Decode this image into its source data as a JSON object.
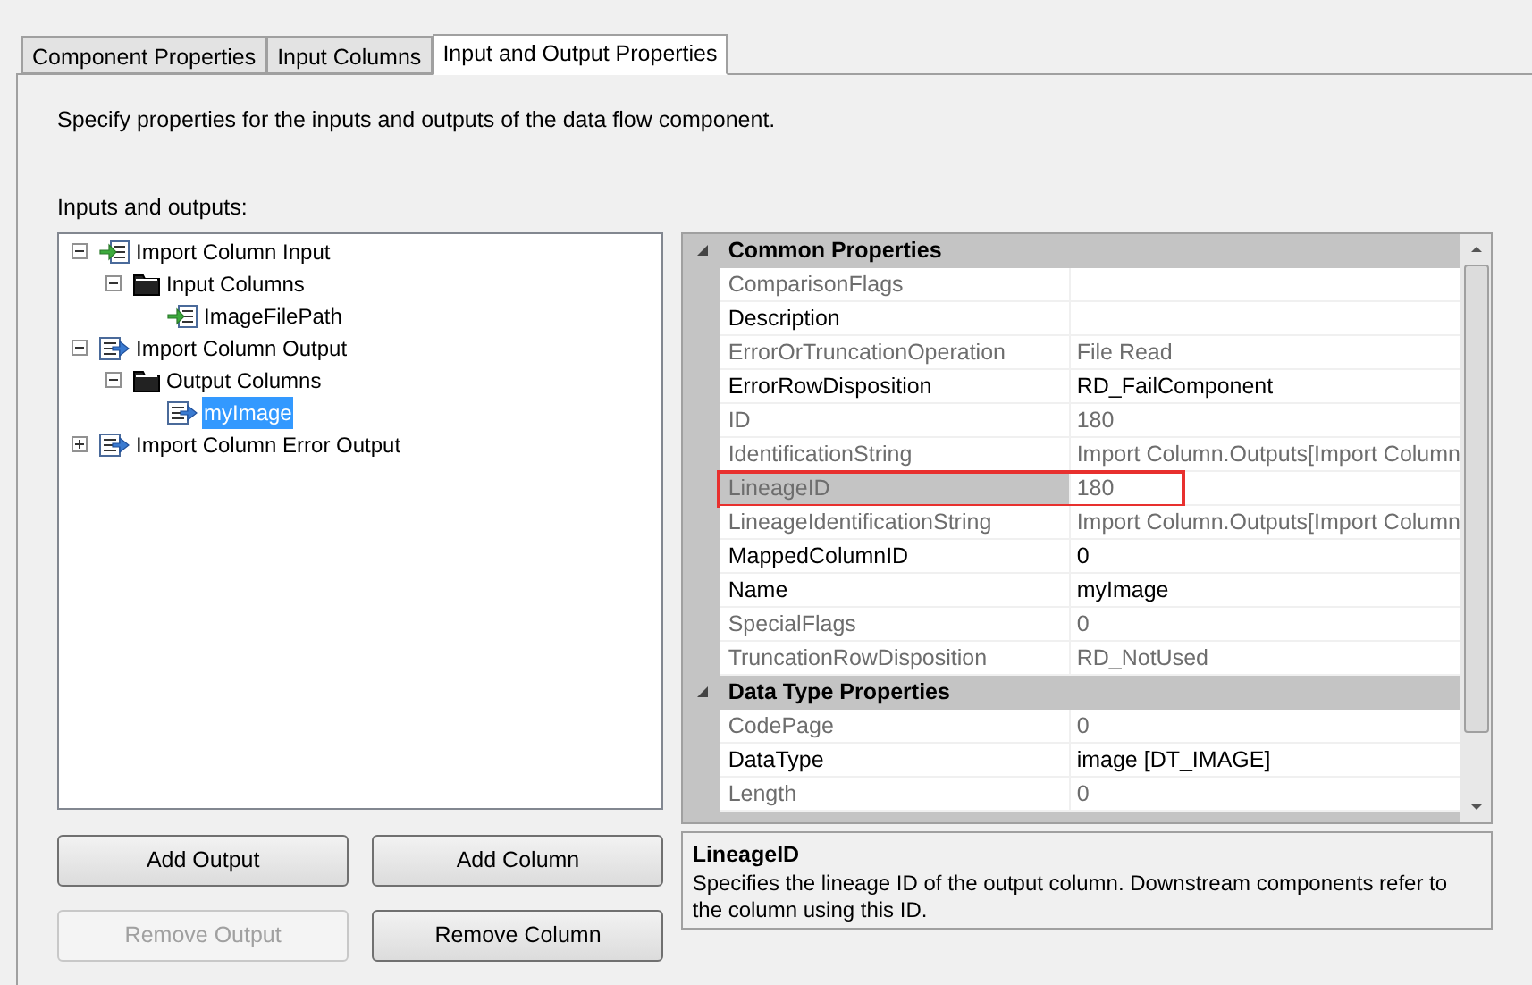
{
  "tabs": [
    {
      "label": "Component Properties",
      "selected": false
    },
    {
      "label": "Input Columns",
      "selected": false
    },
    {
      "label": "Input and Output Properties",
      "selected": true
    }
  ],
  "instructions": "Specify properties for the inputs and outputs of the data flow component.",
  "tree_label": "Inputs and outputs:",
  "tree": [
    {
      "label": "Import Column Input",
      "kind": "input",
      "expanded": true,
      "selected": false,
      "children": [
        {
          "label": "Input Columns",
          "kind": "folder",
          "expanded": true,
          "selected": false,
          "children": [
            {
              "label": "ImageFilePath",
              "kind": "input",
              "selected": false
            }
          ]
        }
      ]
    },
    {
      "label": "Import Column Output",
      "kind": "output",
      "expanded": true,
      "selected": false,
      "children": [
        {
          "label": "Output Columns",
          "kind": "folder",
          "expanded": true,
          "selected": false,
          "children": [
            {
              "label": "myImage",
              "kind": "output",
              "selected": true
            }
          ]
        }
      ]
    },
    {
      "label": "Import Column Error Output",
      "kind": "output",
      "expanded": false,
      "selected": false
    }
  ],
  "categories": [
    {
      "title": "Common Properties",
      "expanded": true,
      "properties": [
        {
          "name": "ComparisonFlags",
          "readonly": true,
          "highlighted": false
        },
        {
          "name": "Description",
          "readonly": false,
          "highlighted": false
        },
        {
          "name": "ErrorOrTruncationOperation",
          "value": "File Read",
          "readonly": true,
          "highlighted": false
        },
        {
          "name": "ErrorRowDisposition",
          "value": "RD_FailComponent",
          "readonly": false,
          "highlighted": false
        },
        {
          "name": "ID",
          "value": "180",
          "readonly": true,
          "highlighted": false
        },
        {
          "name": "IdentificationString",
          "value": "Import Column.Outputs[Import Column",
          "readonly": true,
          "highlighted": false
        },
        {
          "name": "LineageID",
          "value": "180",
          "readonly": true,
          "highlighted": true
        },
        {
          "name": "LineageIdentificationString",
          "value": "Import Column.Outputs[Import Column",
          "readonly": true,
          "highlighted": false
        },
        {
          "name": "MappedColumnID",
          "value": "0",
          "readonly": false,
          "highlighted": false
        },
        {
          "name": "Name",
          "value": "myImage",
          "readonly": false,
          "highlighted": false
        },
        {
          "name": "SpecialFlags",
          "value": "0",
          "readonly": true,
          "highlighted": false
        },
        {
          "name": "TruncationRowDisposition",
          "value": "RD_NotUsed",
          "readonly": true,
          "highlighted": false
        }
      ]
    },
    {
      "title": "Data Type Properties",
      "expanded": true,
      "properties": [
        {
          "name": "CodePage",
          "value": "0",
          "readonly": true,
          "highlighted": false
        },
        {
          "name": "DataType",
          "value": "image [DT_IMAGE]",
          "readonly": false,
          "highlighted": false
        },
        {
          "name": "Length",
          "value": "0",
          "readonly": true,
          "highlighted": false
        }
      ]
    }
  ],
  "description": {
    "title": "LineageID",
    "text": "Specifies the lineage ID of the output column. Downstream components refer to the column using this ID."
  },
  "buttons": [
    {
      "label": "Add Output",
      "disabled": false
    },
    {
      "label": "Add Column",
      "disabled": false
    },
    {
      "label": "Remove Output",
      "disabled": true
    },
    {
      "label": "Remove Column",
      "disabled": false
    }
  ]
}
